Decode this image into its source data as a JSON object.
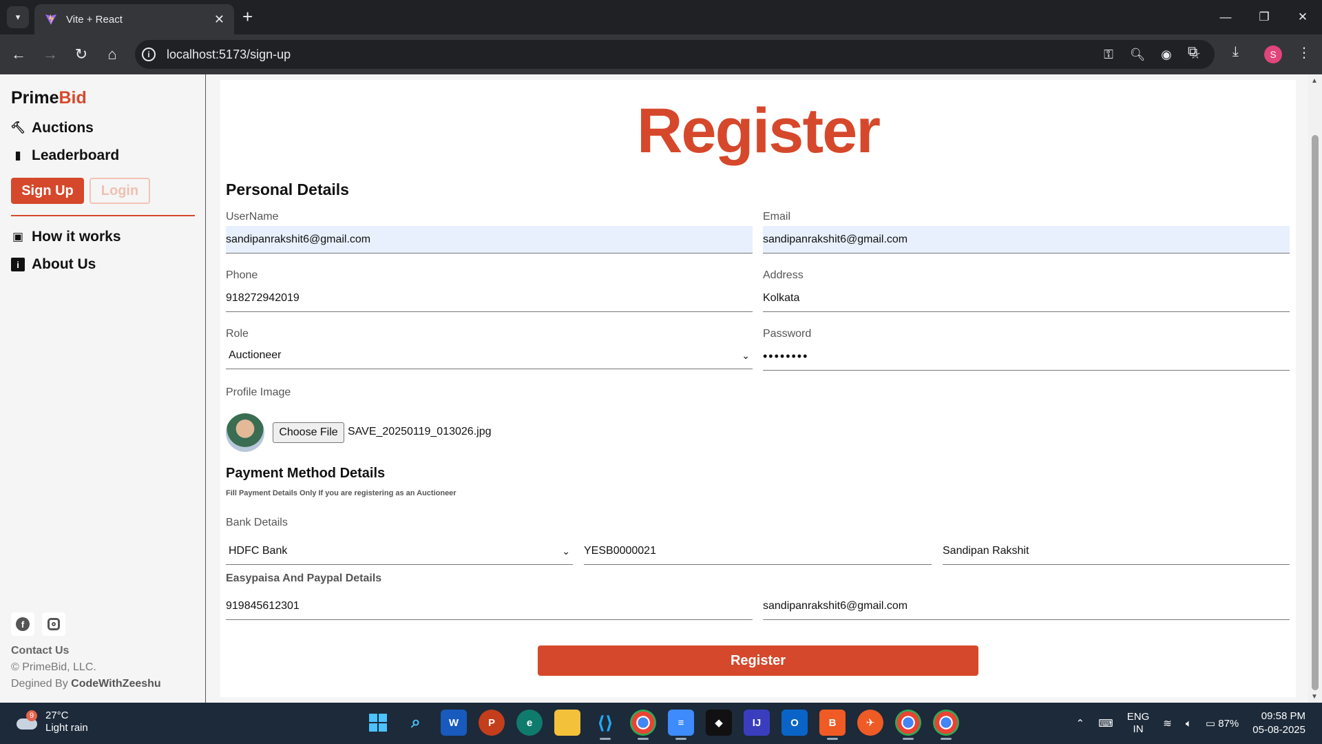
{
  "browser": {
    "tab_title": "Vite + React",
    "url": "localhost:5173/sign-up",
    "profile_initial": "S",
    "window_controls": [
      "minimize-icon",
      "restore-icon",
      "close-icon"
    ]
  },
  "sidebar": {
    "brand_prime": "Prime",
    "brand_bid": "Bid",
    "links": [
      {
        "label": "Auctions",
        "icon": "gavel-icon"
      },
      {
        "label": "Leaderboard",
        "icon": "bar-chart-icon"
      }
    ],
    "signup_label": "Sign Up",
    "login_label": "Login",
    "links2": [
      {
        "label": "How it works",
        "icon": "toolbox-icon"
      },
      {
        "label": "About Us",
        "icon": "info-square-icon"
      }
    ],
    "contact": "Contact Us",
    "copyright": "© PrimeBid, LLC.",
    "designed_prefix": "Degined By ",
    "designed_by": "CodeWithZeeshu"
  },
  "form": {
    "title": "Register",
    "personal_title": "Personal Details",
    "username_label": "UserName",
    "username_value": "sandipanrakshit6@gmail.com",
    "email_label": "Email",
    "email_value": "sandipanrakshit6@gmail.com",
    "phone_label": "Phone",
    "phone_value": "918272942019",
    "address_label": "Address",
    "address_value": "Kolkata",
    "role_label": "Role",
    "role_value": "Auctioneer",
    "password_label": "Password",
    "password_value": "••••••••",
    "profile_label": "Profile Image",
    "choose_file": "Choose File",
    "file_name": "SAVE_20250119_013026.jpg",
    "payment_title": "Payment Method Details",
    "payment_hint": "Fill Payment Details Only If you are registering as an Auctioneer",
    "bank_label": "Bank Details",
    "bank_name": "HDFC Bank",
    "bank_ifsc": "YESB0000021",
    "bank_holder": "Sandipan Rakshit",
    "easypaisa_label": "Easypaisa And Paypal Details",
    "easypaisa_value": "919845612301",
    "paypal_value": "sandipanrakshit6@gmail.com",
    "submit_label": "Register"
  },
  "taskbar": {
    "weather_temp": "27°C",
    "weather_desc": "Light rain",
    "weather_badge": "9",
    "lang1": "ENG",
    "lang2": "IN",
    "battery": "87%",
    "time": "09:58 PM",
    "date": "05-08-2025"
  }
}
